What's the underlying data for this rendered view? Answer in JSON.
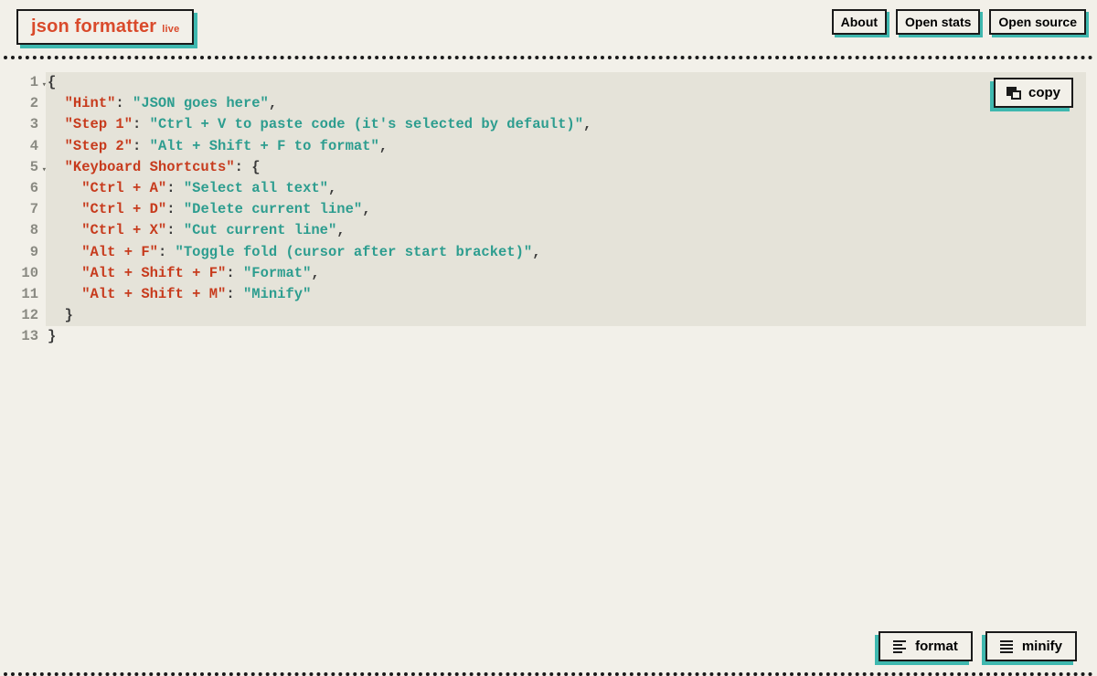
{
  "header": {
    "logo_text": "json formatter",
    "logo_sup": "live",
    "nav": {
      "about": "About",
      "open_stats": "Open stats",
      "open_source": "Open source"
    }
  },
  "editor": {
    "copy_label": "copy",
    "line_numbers": [
      "1",
      "2",
      "3",
      "4",
      "5",
      "6",
      "7",
      "8",
      "9",
      "10",
      "11",
      "12",
      "13"
    ],
    "json": {
      "Hint": "JSON goes here",
      "Step 1": "Ctrl + V to paste code (it's selected by default)",
      "Step 2": "Alt + Shift + F to format",
      "Keyboard Shortcuts": {
        "Ctrl + A": "Select all text",
        "Ctrl + D": "Delete current line",
        "Ctrl + X": "Cut current line",
        "Alt + F": "Toggle fold (cursor after start bracket)",
        "Alt + Shift + F": "Format",
        "Alt + Shift + M": "Minify"
      }
    },
    "lines": [
      {
        "indent": 0,
        "type": "open",
        "text": "{"
      },
      {
        "indent": 1,
        "type": "kv",
        "key": "Hint",
        "value": "JSON goes here",
        "comma": true
      },
      {
        "indent": 1,
        "type": "kv",
        "key": "Step 1",
        "value": "Ctrl + V to paste code (it's selected by default)",
        "comma": true
      },
      {
        "indent": 1,
        "type": "kv",
        "key": "Step 2",
        "value": "Alt + Shift + F to format",
        "comma": true
      },
      {
        "indent": 1,
        "type": "ko",
        "key": "Keyboard Shortcuts"
      },
      {
        "indent": 2,
        "type": "kv",
        "key": "Ctrl + A",
        "value": "Select all text",
        "comma": true
      },
      {
        "indent": 2,
        "type": "kv",
        "key": "Ctrl + D",
        "value": "Delete current line",
        "comma": true
      },
      {
        "indent": 2,
        "type": "kv",
        "key": "Ctrl + X",
        "value": "Cut current line",
        "comma": true
      },
      {
        "indent": 2,
        "type": "kv",
        "key": "Alt + F",
        "value": "Toggle fold (cursor after start bracket)",
        "comma": true
      },
      {
        "indent": 2,
        "type": "kv",
        "key": "Alt + Shift + F",
        "value": "Format",
        "comma": true
      },
      {
        "indent": 2,
        "type": "kv",
        "key": "Alt + Shift + M",
        "value": "Minify",
        "comma": false
      },
      {
        "indent": 1,
        "type": "close",
        "text": "}"
      },
      {
        "indent": 0,
        "type": "close",
        "text": "}"
      }
    ],
    "highlighted_lines_end": 12,
    "fold_lines": [
      1,
      5
    ]
  },
  "footer": {
    "format": "format",
    "minify": "minify"
  }
}
